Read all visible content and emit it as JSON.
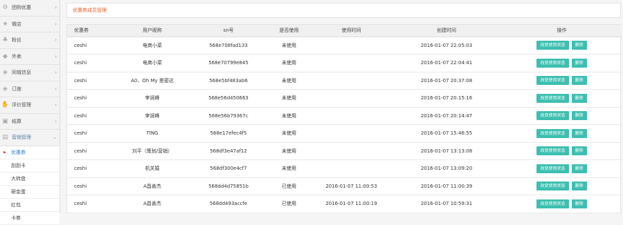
{
  "sidebar": {
    "items": [
      {
        "label": "团购优惠",
        "icon": "group-buy-icon"
      },
      {
        "label": "微店",
        "icon": "star-icon"
      },
      {
        "label": "粉丝",
        "icon": "fans-icon"
      },
      {
        "label": "外卖",
        "icon": "takeout-icon"
      },
      {
        "label": "同城信息",
        "icon": "tag-icon"
      },
      {
        "label": "订座",
        "icon": "tag-icon"
      },
      {
        "label": "评价管理",
        "icon": "thumb-icon"
      },
      {
        "label": "结算",
        "icon": "image-icon"
      },
      {
        "label": "营销管理",
        "icon": "marketing-icon"
      }
    ],
    "sub_items": [
      "优惠券",
      "刮刮卡",
      "大转盘",
      "砸金蛋",
      "红包",
      "卡劵"
    ]
  },
  "page": {
    "title": "优惠券成员管理"
  },
  "table": {
    "headers": [
      "优惠券",
      "用户昵称",
      "sn号",
      "是否使用",
      "使用时间",
      "创建时间",
      "操作"
    ],
    "action_labels": {
      "change": "改变使用状态",
      "delete": "删除"
    },
    "rows": [
      [
        "ceshi",
        "电商小菜",
        "568e708fad133",
        "未使用",
        "",
        "2016-01-07 22:05:03"
      ],
      [
        "ceshi",
        "电商小菜",
        "568e70799e845",
        "未使用",
        "",
        "2016-01-07 22:04:41"
      ],
      [
        "ceshi",
        "A0、Oh My 思密达",
        "568e5bf483ab6",
        "未使用",
        "",
        "2016-01-07 20:37:08"
      ],
      [
        "ceshi",
        "李润峰",
        "568e56d450663",
        "未使用",
        "",
        "2016-01-07 20:15:16"
      ],
      [
        "ceshi",
        "李润峰",
        "568e56b79367c",
        "未使用",
        "",
        "2016-01-07 20:14:47"
      ],
      [
        "ceshi",
        "TING",
        "568e17efec4f5",
        "未使用",
        "",
        "2016-01-07 15:46:55"
      ],
      [
        "ceshi",
        "刘平（策划/营销）",
        "568df3e47af12",
        "未使用",
        "",
        "2016-01-07 13:13:08"
      ],
      [
        "ceshi",
        "机关猿",
        "568df300e4cf7",
        "未使用",
        "",
        "2016-01-07 13:09:20"
      ],
      [
        "ceshi",
        "A昌善杰",
        "568dd4d75851b",
        "已使用",
        "2016-01-07 11:00:53",
        "2016-01-07 11:00:39"
      ],
      [
        "ceshi",
        "A昌善杰",
        "568dd493accfe",
        "已使用",
        "2016-01-07 11:00:19",
        "2016-01-07 10:59:31"
      ]
    ]
  }
}
